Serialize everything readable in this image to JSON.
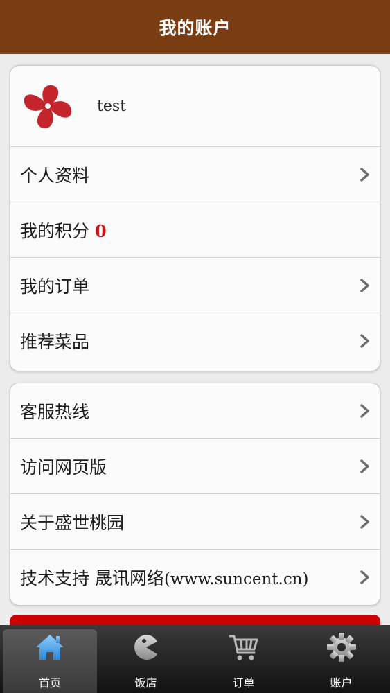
{
  "header": {
    "title": "我的账户"
  },
  "profile": {
    "username": "test",
    "avatar_icon": "logo-avatar-icon"
  },
  "menu_group_1": {
    "items": [
      {
        "label": "个人资料",
        "icon": "chevron-right-icon"
      },
      {
        "label": "我的积分",
        "value": "0"
      },
      {
        "label": "我的订单",
        "icon": "chevron-right-icon"
      },
      {
        "label": "推荐菜品",
        "icon": "chevron-right-icon"
      }
    ]
  },
  "menu_group_2": {
    "items": [
      {
        "label": "客服热线",
        "icon": "chevron-right-icon"
      },
      {
        "label": "访问网页版",
        "icon": "chevron-right-icon"
      },
      {
        "label": "关于盛世桃园",
        "icon": "chevron-right-icon"
      },
      {
        "label_prefix": "技术支持 晟讯网络",
        "label_suffix": "(www.suncent.cn)",
        "icon": "chevron-right-icon"
      }
    ]
  },
  "tabbar": {
    "tabs": [
      {
        "label": "首页",
        "icon": "home-icon",
        "active": true
      },
      {
        "label": "饭店",
        "icon": "pacman-icon",
        "active": false
      },
      {
        "label": "订单",
        "icon": "cart-icon",
        "active": false
      },
      {
        "label": "账户",
        "icon": "gear-icon",
        "active": false
      }
    ]
  },
  "colors": {
    "header_bg": "#7a3c12",
    "points_value": "#cc1111",
    "logout_button": "#cc0000",
    "tab_home_icon": "#4aa3e8"
  }
}
